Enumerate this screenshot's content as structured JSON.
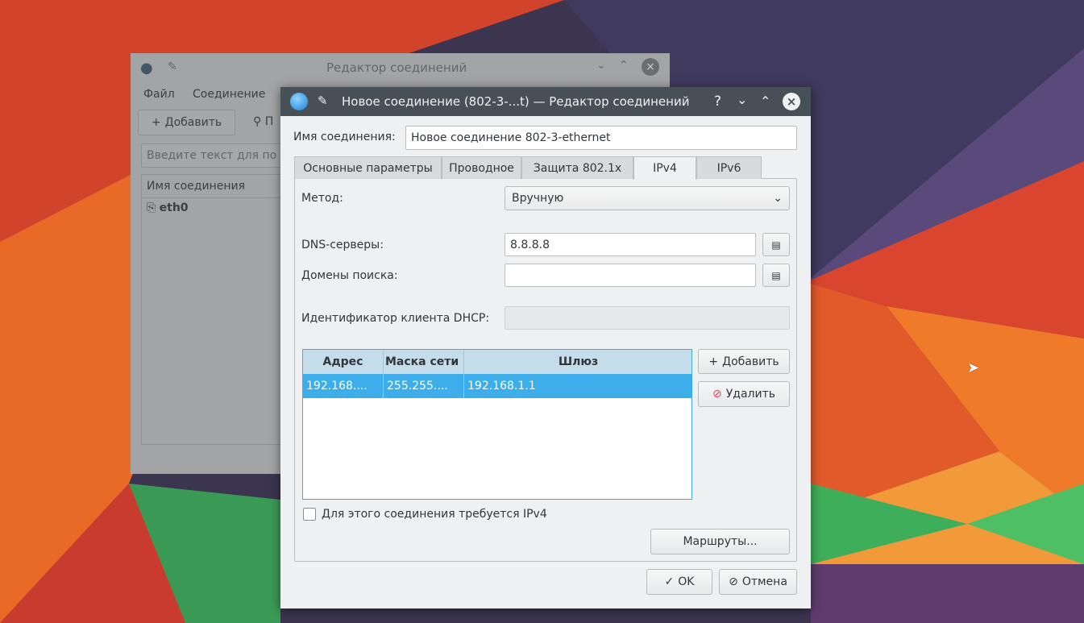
{
  "background_window": {
    "title": "Редактор соединений",
    "menu": [
      "Файл",
      "Соединение"
    ],
    "toolbar": {
      "add_label": "Добавить",
      "second_label": "П"
    },
    "search_placeholder": "Введите текст для по",
    "list_header": "Имя соединения",
    "connections": [
      {
        "name": "eth0"
      }
    ]
  },
  "dialog": {
    "title": "Новое соединение (802-3-...t) — Редактор соединений",
    "title_buttons": {
      "help": "?"
    },
    "name_label": "Имя соединения:",
    "name_value": "Новое соединение 802-3-ethernet",
    "tabs": [
      {
        "label": "Основные параметры"
      },
      {
        "label": "Проводное"
      },
      {
        "label": "Защита 802.1x"
      },
      {
        "label": "IPv4",
        "active": true
      },
      {
        "label": "IPv6"
      }
    ],
    "method_label": "Метод:",
    "method_value": "Вручную",
    "dns_label": "DNS-серверы:",
    "dns_value": "8.8.8.8",
    "domains_label": "Домены поиска:",
    "domains_value": "",
    "dhcp_label": "Идентификатор клиента DHCP:",
    "dhcp_value": "",
    "addresses": {
      "columns": [
        "Адрес",
        "Маска сети",
        "Шлюз"
      ],
      "rows": [
        [
          "192.168....",
          "255.255....",
          "192.168.1.1"
        ]
      ]
    },
    "add_label": "Добавить",
    "delete_label": "Удалить",
    "require_ipv4_label": "Для этого соединения требуется IPv4",
    "require_ipv4_checked": false,
    "routes_label": "Маршруты...",
    "ok_label": "OK",
    "cancel_label": "Отмена"
  },
  "colors": {
    "selection": "#3daee9",
    "titlebar": "#475057",
    "dialog_bg": "#eff0f1"
  }
}
